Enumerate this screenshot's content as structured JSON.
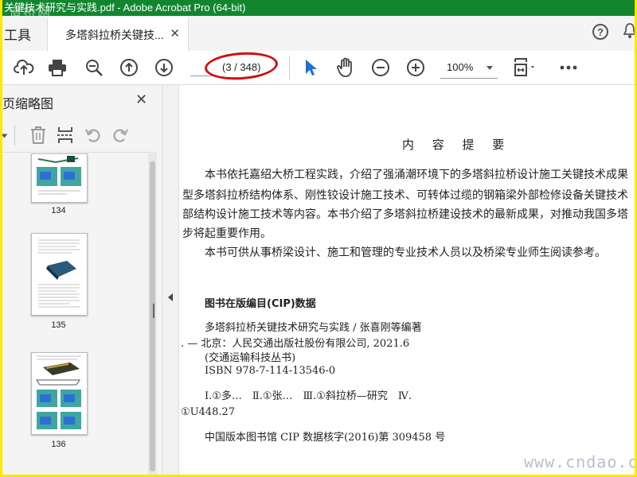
{
  "window": {
    "title": "关键技术研究与实践.pdf - Adobe Acrobat Pro (64-bit)",
    "watermark_top": "道桥网"
  },
  "tabs": {
    "tools_label": "工具",
    "doc_tab_label": "多塔斜拉桥关键技..."
  },
  "toolbar": {
    "page_indicator": "(3 / 348)",
    "zoom_value": "100%"
  },
  "sidebar": {
    "title": "页缩略图",
    "thumbnails": [
      {
        "label": "134"
      },
      {
        "label": "135"
      },
      {
        "label": "136"
      }
    ]
  },
  "document": {
    "heading": "内 容 提 要",
    "lines": [
      "本书依托嘉绍大桥工程实践，介绍了强涌潮环境下的多塔斜拉桥设计施工关键技术成果",
      "型多塔斜拉桥结构体系、刚性铰设计施工技术、可转体过缆的钢箱梁外部检修设备关键技术",
      "部结构设计施工技术等内容。本书介绍了多塔斜拉桥建设技术的最新成果，对推动我国多塔",
      "步将起重要作用。",
      "本书可供从事桥梁设计、施工和管理的专业技术人员以及桥梁专业师生阅读参考。"
    ],
    "cip_heading": "图书在版编目(CIP)数据",
    "cip_lines": [
      "多塔斜拉桥关键技术研究与实践 / 张喜刚等编著",
      ". — 北京：人民交通出版社股份有限公司, 2021.6",
      "(交通运输科技丛书)",
      "ISBN 978-7-114-13546-0",
      "Ⅰ.①多…　Ⅱ.①张…　Ⅲ.①斜拉桥—研究　Ⅳ.",
      "①U448.27",
      "中国版本图书馆 CIP 数据核字(2016)第 309458 号"
    ]
  },
  "watermark_bottom": "www.cndao.com",
  "colors": {
    "title_bar": "#12862f",
    "highlight_ring": "#d10f0f",
    "outer_border": "#ffe600",
    "select_tool": "#1f6fd6"
  }
}
